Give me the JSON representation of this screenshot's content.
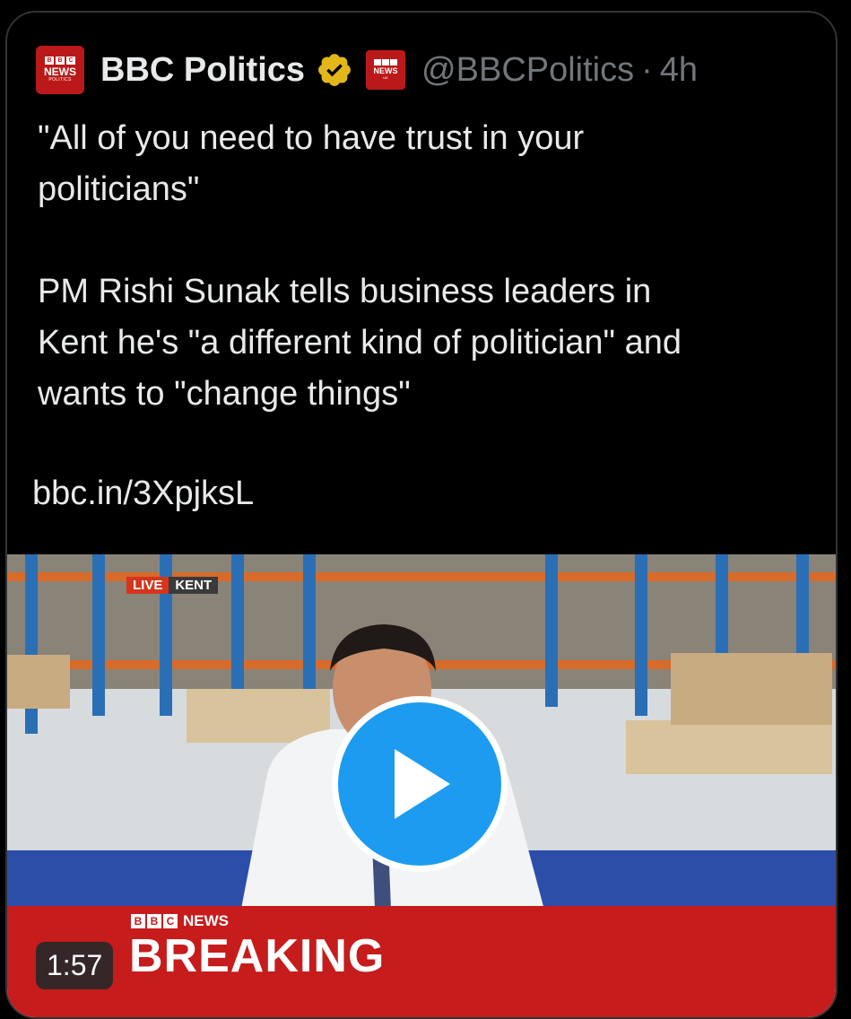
{
  "tweet": {
    "author_name": "BBC Politics",
    "handle": "@BBCPolitics",
    "separator": "·",
    "time": "4h",
    "text": "\"All of you need to have trust in your\npoliticians\"\n\nPM Rishi Sunak tells business leaders in\nKent he's \"a different kind of politician\" and\nwants to \"change things\"",
    "link": "bbc.in/3XpjksL"
  },
  "avatar": {
    "line1": "NEWS",
    "line2": "POLITICS",
    "color": "#bb1919"
  },
  "affiliate_badge": {
    "line1": "NEWS",
    "line2": "UK"
  },
  "verified_icon": "verified-badge-gold",
  "video": {
    "live_label": "LIVE",
    "location_label": "KENT",
    "channel_label": "NEWS",
    "headline": "BREAKING",
    "duration": "1:57",
    "play_icon": "play-icon",
    "accent_color": "#1d9bf0"
  }
}
